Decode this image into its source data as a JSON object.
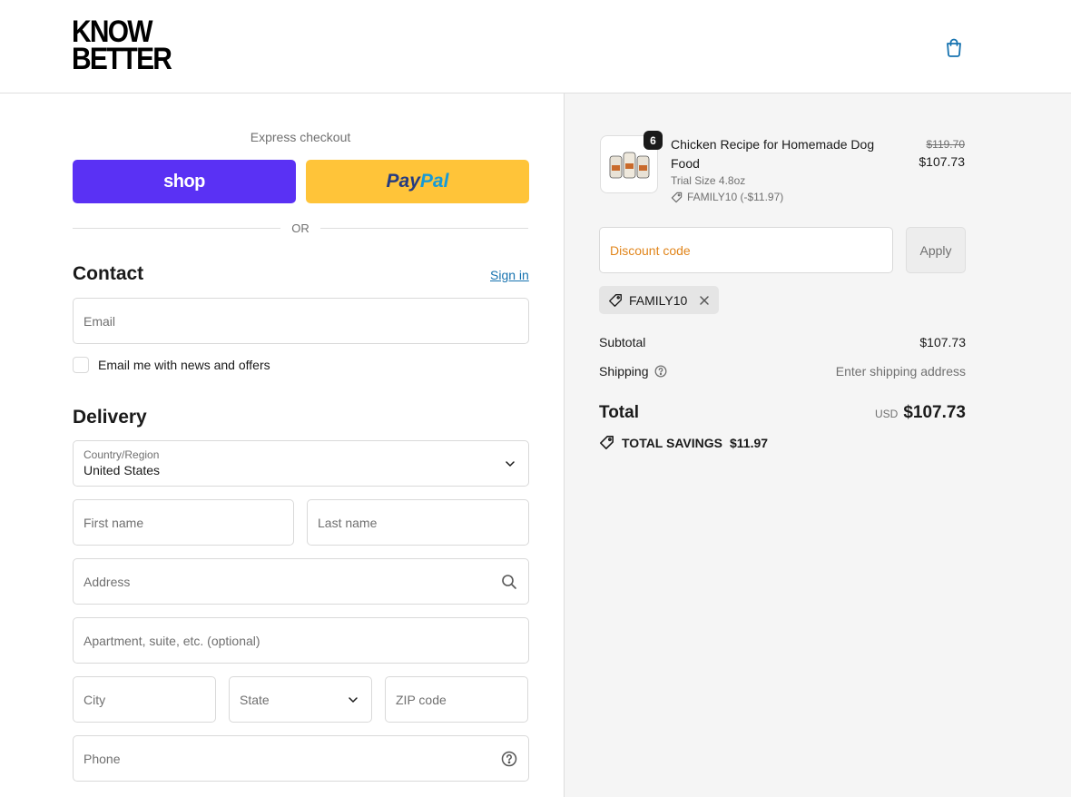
{
  "header": {
    "logo_line1": "KNOW",
    "logo_line2": "BETTER",
    "cart_icon": "shopping-bag-icon"
  },
  "express": {
    "title": "Express checkout",
    "shop_label": "shop",
    "paypal_pay": "Pay",
    "paypal_pal": "Pal",
    "or_label": "OR"
  },
  "contact": {
    "heading": "Contact",
    "signin": "Sign in",
    "email_placeholder": "Email",
    "newsletter_label": "Email me with news and offers"
  },
  "delivery": {
    "heading": "Delivery",
    "country_label": "Country/Region",
    "country_value": "United States",
    "first_name": "First name",
    "last_name": "Last name",
    "address": "Address",
    "apartment": "Apartment, suite, etc. (optional)",
    "city": "City",
    "state": "State",
    "zip": "ZIP code",
    "phone": "Phone"
  },
  "summary": {
    "item": {
      "quantity": "6",
      "name": "Chicken Recipe for Homemade Dog Food",
      "variant": "Trial Size 4.8oz",
      "discount": "FAMILY10 (-$11.97)",
      "price_original": "$119.70",
      "price_final": "$107.73"
    },
    "discount_placeholder": "Discount code",
    "apply_label": "Apply",
    "applied_code": "FAMILY10",
    "subtotal_label": "Subtotal",
    "subtotal_value": "$107.73",
    "shipping_label": "Shipping",
    "shipping_value": "Enter shipping address",
    "total_label": "Total",
    "total_currency": "USD",
    "total_value": "$107.73",
    "savings_label": "TOTAL SAVINGS",
    "savings_value": "$11.97"
  },
  "colors": {
    "shop_button": "#5a31f4",
    "paypal_button": "#ffc439",
    "link": "#1773b0",
    "summary_bg": "#f5f5f5"
  }
}
